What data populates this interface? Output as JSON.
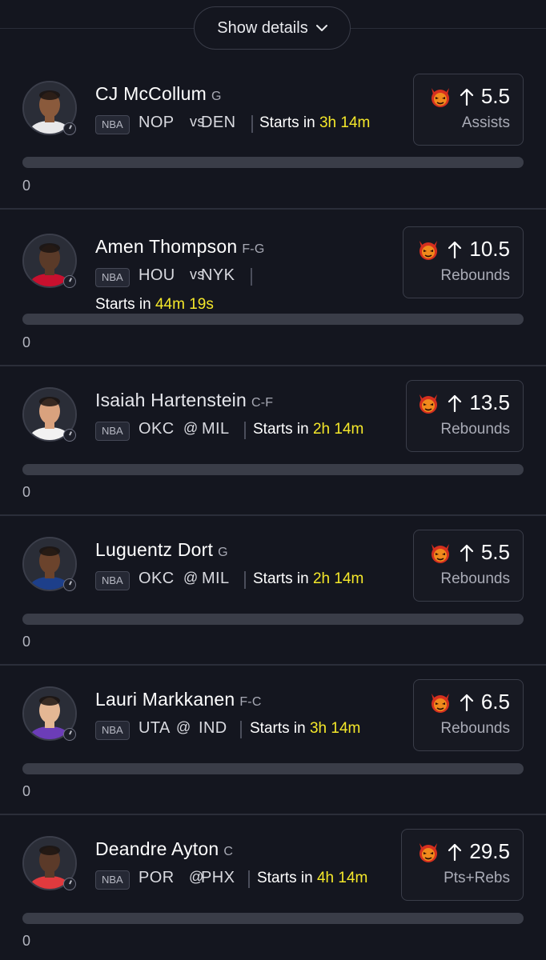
{
  "header": {
    "show_details_label": "Show details"
  },
  "icons": {
    "team_logo": "devil-head-icon",
    "direction": "arrow-up-icon",
    "clock": "clock-icon",
    "toggle": "chevron-down-icon"
  },
  "colors": {
    "background": "#14161f",
    "accent_time": "#f5e82a",
    "bar": "#3a3d48",
    "border": "#3a3d49"
  },
  "players": [
    {
      "name": "CJ McCollum",
      "position": "G",
      "league": "NBA",
      "home": "NOP",
      "connector": "vs",
      "away": "DEN",
      "starts_label": "Starts in",
      "starts_time": "3h 14m",
      "line": "5.5",
      "stat": "Assists",
      "count": "0"
    },
    {
      "name": "Amen Thompson",
      "position": "F-G",
      "league": "NBA",
      "home": "HOU",
      "connector": "vs",
      "away": "NYK",
      "starts_label": "Starts in",
      "starts_time": "44m 19s",
      "line": "10.5",
      "stat": "Rebounds",
      "count": "0"
    },
    {
      "name": "Isaiah Hartenstein",
      "position": "C-F",
      "league": "NBA",
      "home": "OKC",
      "connector": "@",
      "away": "MIL",
      "starts_label": "Starts in",
      "starts_time": "2h 14m",
      "line": "13.5",
      "stat": "Rebounds",
      "count": "0"
    },
    {
      "name": "Luguentz Dort",
      "position": "G",
      "league": "NBA",
      "home": "OKC",
      "connector": "@",
      "away": "MIL",
      "starts_label": "Starts in",
      "starts_time": "2h 14m",
      "line": "5.5",
      "stat": "Rebounds",
      "count": "0"
    },
    {
      "name": "Lauri Markkanen",
      "position": "F-C",
      "league": "NBA",
      "home": "UTA",
      "connector": "@",
      "away": "IND",
      "starts_label": "Starts in",
      "starts_time": "3h 14m",
      "line": "6.5",
      "stat": "Rebounds",
      "count": "0"
    },
    {
      "name": "Deandre Ayton",
      "position": "C",
      "league": "NBA",
      "home": "POR",
      "connector": "@",
      "away": "PHX",
      "starts_label": "Starts in",
      "starts_time": "4h 14m",
      "line": "29.5",
      "stat": "Pts+Rebs",
      "count": "0"
    }
  ]
}
